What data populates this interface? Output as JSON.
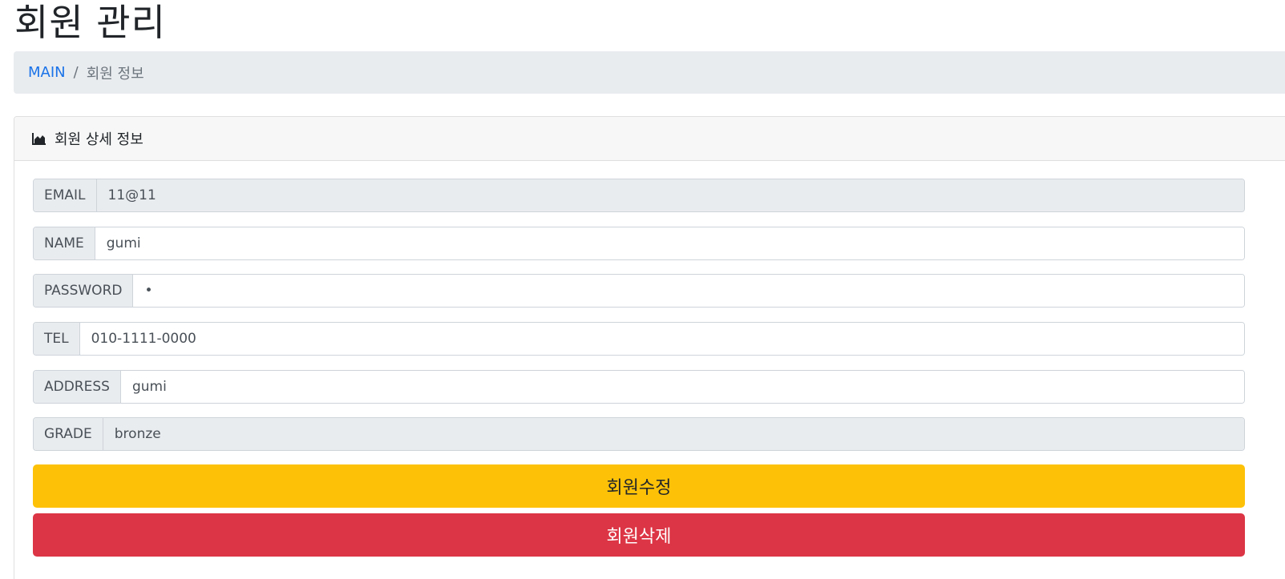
{
  "page": {
    "title": "회원 관리"
  },
  "breadcrumb": {
    "home": "MAIN",
    "separator": "/",
    "current": "회원 정보"
  },
  "card": {
    "header_icon": "area-chart-icon",
    "header_title": "회원 상세 정보"
  },
  "form": {
    "email": {
      "label": "EMAIL",
      "value": "11@11",
      "readonly": true
    },
    "name": {
      "label": "NAME",
      "value": "gumi"
    },
    "password": {
      "label": "PASSWORD",
      "value": "•"
    },
    "tel": {
      "label": "TEL",
      "value": "010-1111-0000"
    },
    "address": {
      "label": "ADDRESS",
      "value": "gumi"
    },
    "grade": {
      "label": "GRADE",
      "value": "bronze",
      "readonly": true
    }
  },
  "actions": {
    "update_label": "회원수정",
    "delete_label": "회원삭제"
  },
  "colors": {
    "primary_link": "#1a73e8",
    "warning": "#fdc108",
    "danger": "#dc3545",
    "addon_bg": "#e9ecef"
  }
}
